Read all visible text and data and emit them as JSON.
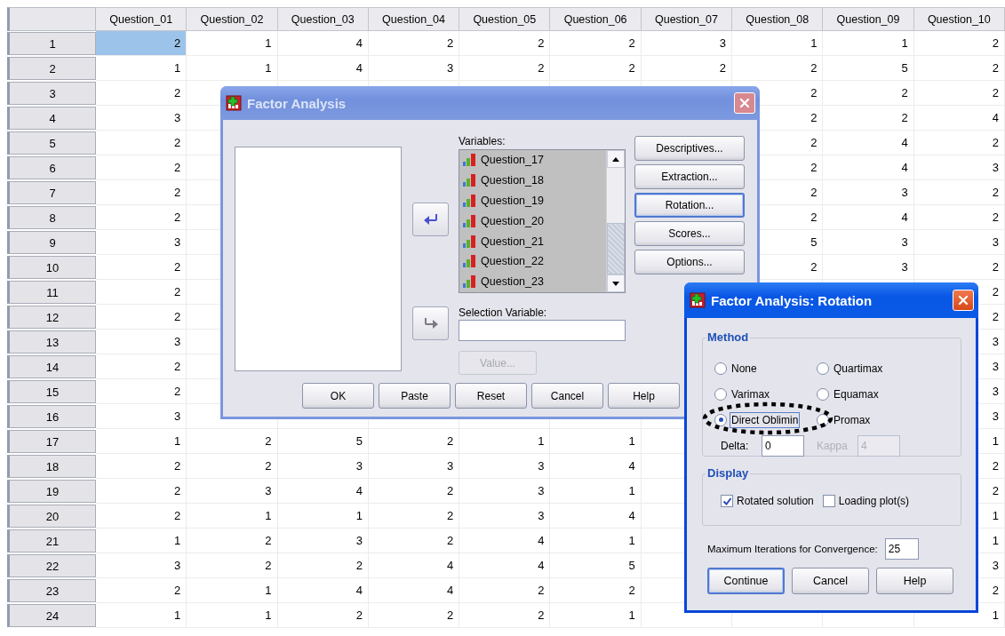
{
  "data_grid": {
    "columns": [
      "Question_01",
      "Question_02",
      "Question_03",
      "Question_04",
      "Question_05",
      "Question_06",
      "Question_07",
      "Question_08",
      "Question_09",
      "Question_10"
    ],
    "rows": [
      {
        "label": "1",
        "cells": [
          {
            "text": "2",
            "selected": true
          },
          {
            "text": "1",
            "selected": false
          },
          {
            "text": "4",
            "selected": false
          },
          {
            "text": "2",
            "selected": false
          },
          {
            "text": "2",
            "selected": false
          },
          {
            "text": "2",
            "selected": false
          },
          {
            "text": "3",
            "selected": false
          },
          {
            "text": "1",
            "selected": false
          },
          {
            "text": "1",
            "selected": false
          },
          {
            "text": "2",
            "selected": false
          }
        ]
      },
      {
        "label": "2",
        "cells": [
          {
            "text": "1",
            "selected": false
          },
          {
            "text": "1",
            "selected": false
          },
          {
            "text": "4",
            "selected": false
          },
          {
            "text": "3",
            "selected": false
          },
          {
            "text": "2",
            "selected": false
          },
          {
            "text": "2",
            "selected": false
          },
          {
            "text": "2",
            "selected": false
          },
          {
            "text": "2",
            "selected": false
          },
          {
            "text": "5",
            "selected": false
          },
          {
            "text": "2",
            "selected": false
          }
        ]
      },
      {
        "label": "3",
        "cells": [
          {
            "text": "2",
            "selected": false
          },
          null,
          null,
          null,
          null,
          null,
          null,
          {
            "text": "2",
            "selected": false
          },
          {
            "text": "2",
            "selected": false
          },
          {
            "text": "2",
            "selected": false
          }
        ]
      },
      {
        "label": "4",
        "cells": [
          {
            "text": "3",
            "selected": false
          },
          null,
          null,
          null,
          null,
          null,
          null,
          {
            "text": "2",
            "selected": false
          },
          {
            "text": "2",
            "selected": false
          },
          {
            "text": "4",
            "selected": false
          }
        ]
      },
      {
        "label": "5",
        "cells": [
          {
            "text": "2",
            "selected": false
          },
          null,
          null,
          null,
          null,
          null,
          null,
          {
            "text": "2",
            "selected": false
          },
          {
            "text": "4",
            "selected": false
          },
          {
            "text": "2",
            "selected": false
          }
        ]
      },
      {
        "label": "6",
        "cells": [
          {
            "text": "2",
            "selected": false
          },
          null,
          null,
          null,
          null,
          null,
          null,
          {
            "text": "2",
            "selected": false
          },
          {
            "text": "4",
            "selected": false
          },
          {
            "text": "3",
            "selected": false
          }
        ]
      },
      {
        "label": "7",
        "cells": [
          {
            "text": "2",
            "selected": false
          },
          null,
          null,
          null,
          null,
          null,
          null,
          {
            "text": "2",
            "selected": false
          },
          {
            "text": "3",
            "selected": false
          },
          {
            "text": "2",
            "selected": false
          }
        ]
      },
      {
        "label": "8",
        "cells": [
          {
            "text": "2",
            "selected": false
          },
          null,
          null,
          null,
          null,
          null,
          null,
          {
            "text": "2",
            "selected": false
          },
          {
            "text": "4",
            "selected": false
          },
          {
            "text": "2",
            "selected": false
          }
        ]
      },
      {
        "label": "9",
        "cells": [
          {
            "text": "3",
            "selected": false
          },
          null,
          null,
          null,
          null,
          null,
          null,
          {
            "text": "5",
            "selected": false
          },
          {
            "text": "3",
            "selected": false
          },
          {
            "text": "3",
            "selected": false
          }
        ]
      },
      {
        "label": "10",
        "cells": [
          {
            "text": "2",
            "selected": false
          },
          null,
          null,
          null,
          null,
          null,
          null,
          {
            "text": "2",
            "selected": false
          },
          {
            "text": "3",
            "selected": false
          },
          {
            "text": "2",
            "selected": false
          }
        ]
      },
      {
        "label": "11",
        "cells": [
          {
            "text": "2",
            "selected": false
          },
          null,
          null,
          null,
          null,
          null,
          null,
          null,
          null,
          {
            "text": "2",
            "selected": false
          }
        ]
      },
      {
        "label": "12",
        "cells": [
          {
            "text": "2",
            "selected": false
          },
          null,
          null,
          null,
          null,
          null,
          null,
          null,
          null,
          {
            "text": "2",
            "selected": false
          }
        ]
      },
      {
        "label": "13",
        "cells": [
          {
            "text": "3",
            "selected": false
          },
          null,
          null,
          null,
          null,
          null,
          null,
          null,
          null,
          {
            "text": "3",
            "selected": false
          }
        ]
      },
      {
        "label": "14",
        "cells": [
          {
            "text": "2",
            "selected": false
          },
          null,
          null,
          null,
          null,
          null,
          null,
          null,
          null,
          {
            "text": "3",
            "selected": false
          }
        ]
      },
      {
        "label": "15",
        "cells": [
          {
            "text": "2",
            "selected": false
          },
          null,
          null,
          null,
          null,
          null,
          null,
          null,
          null,
          {
            "text": "3",
            "selected": false
          }
        ]
      },
      {
        "label": "16",
        "cells": [
          {
            "text": "3",
            "selected": false
          },
          null,
          null,
          null,
          null,
          null,
          null,
          null,
          null,
          {
            "text": "3",
            "selected": false
          }
        ]
      },
      {
        "label": "17",
        "cells": [
          {
            "text": "1",
            "selected": false
          },
          {
            "text": "2",
            "selected": false
          },
          {
            "text": "5",
            "selected": false
          },
          {
            "text": "2",
            "selected": false
          },
          {
            "text": "1",
            "selected": false
          },
          {
            "text": "1",
            "selected": false
          },
          null,
          null,
          null,
          {
            "text": "1",
            "selected": false
          }
        ]
      },
      {
        "label": "18",
        "cells": [
          {
            "text": "2",
            "selected": false
          },
          {
            "text": "2",
            "selected": false
          },
          {
            "text": "3",
            "selected": false
          },
          {
            "text": "3",
            "selected": false
          },
          {
            "text": "3",
            "selected": false
          },
          {
            "text": "4",
            "selected": false
          },
          null,
          null,
          null,
          {
            "text": "2",
            "selected": false
          }
        ]
      },
      {
        "label": "19",
        "cells": [
          {
            "text": "2",
            "selected": false
          },
          {
            "text": "3",
            "selected": false
          },
          {
            "text": "4",
            "selected": false
          },
          {
            "text": "2",
            "selected": false
          },
          {
            "text": "3",
            "selected": false
          },
          {
            "text": "1",
            "selected": false
          },
          null,
          null,
          null,
          {
            "text": "2",
            "selected": false
          }
        ]
      },
      {
        "label": "20",
        "cells": [
          {
            "text": "2",
            "selected": false
          },
          {
            "text": "1",
            "selected": false
          },
          {
            "text": "1",
            "selected": false
          },
          {
            "text": "2",
            "selected": false
          },
          {
            "text": "3",
            "selected": false
          },
          {
            "text": "4",
            "selected": false
          },
          null,
          null,
          null,
          {
            "text": "1",
            "selected": false
          }
        ]
      },
      {
        "label": "21",
        "cells": [
          {
            "text": "1",
            "selected": false
          },
          {
            "text": "2",
            "selected": false
          },
          {
            "text": "3",
            "selected": false
          },
          {
            "text": "2",
            "selected": false
          },
          {
            "text": "4",
            "selected": false
          },
          {
            "text": "1",
            "selected": false
          },
          null,
          null,
          null,
          {
            "text": "1",
            "selected": false
          }
        ]
      },
      {
        "label": "22",
        "cells": [
          {
            "text": "3",
            "selected": false
          },
          {
            "text": "2",
            "selected": false
          },
          {
            "text": "2",
            "selected": false
          },
          {
            "text": "4",
            "selected": false
          },
          {
            "text": "4",
            "selected": false
          },
          {
            "text": "5",
            "selected": false
          },
          null,
          null,
          null,
          {
            "text": "3",
            "selected": false
          }
        ]
      },
      {
        "label": "23",
        "cells": [
          {
            "text": "2",
            "selected": false
          },
          {
            "text": "1",
            "selected": false
          },
          {
            "text": "4",
            "selected": false
          },
          {
            "text": "4",
            "selected": false
          },
          {
            "text": "2",
            "selected": false
          },
          {
            "text": "2",
            "selected": false
          },
          null,
          null,
          null,
          {
            "text": "2",
            "selected": false
          }
        ]
      },
      {
        "label": "24",
        "cells": [
          {
            "text": "1",
            "selected": false
          },
          {
            "text": "1",
            "selected": false
          },
          {
            "text": "2",
            "selected": false
          },
          {
            "text": "2",
            "selected": false
          },
          {
            "text": "2",
            "selected": false
          },
          {
            "text": "1",
            "selected": false
          },
          null,
          null,
          null,
          {
            "text": "1",
            "selected": false
          }
        ]
      }
    ]
  },
  "factor_analysis_dialog": {
    "title": "Factor Analysis",
    "active": false,
    "variables_label": "Variables:",
    "variables": [
      {
        "name": "Question_17",
        "selected": true
      },
      {
        "name": "Question_18",
        "selected": true
      },
      {
        "name": "Question_19",
        "selected": true
      },
      {
        "name": "Question_20",
        "selected": true
      },
      {
        "name": "Question_21",
        "selected": true
      },
      {
        "name": "Question_22",
        "selected": true
      },
      {
        "name": "Question_23",
        "selected": true
      }
    ],
    "selection_variable_label": "Selection Variable:",
    "value_button": {
      "label": "Value...",
      "disabled": true
    },
    "side_buttons": [
      {
        "label": "Descriptives...",
        "focused": false
      },
      {
        "label": "Extraction...",
        "focused": false
      },
      {
        "label": "Rotation...",
        "focused": true
      },
      {
        "label": "Scores...",
        "focused": false
      },
      {
        "label": "Options...",
        "focused": false
      }
    ],
    "bottom_buttons": [
      {
        "label": "OK",
        "focused": false
      },
      {
        "label": "Paste",
        "focused": false
      },
      {
        "label": "Reset",
        "focused": false
      },
      {
        "label": "Cancel",
        "focused": false
      },
      {
        "label": "Help",
        "focused": false
      }
    ]
  },
  "rotation_dialog": {
    "title": "Factor Analysis: Rotation",
    "active": true,
    "method_label": "Method",
    "methods": [
      {
        "label": "None",
        "selected": false
      },
      {
        "label": "Quartimax",
        "selected": false
      },
      {
        "label": "Varimax",
        "selected": false
      },
      {
        "label": "Equamax",
        "selected": false
      },
      {
        "label": "Direct Oblimin",
        "selected": true
      },
      {
        "label": "Promax",
        "selected": false
      }
    ],
    "delta": {
      "label": "Delta:",
      "value": "0",
      "disabled": false
    },
    "kappa": {
      "label": "Kappa",
      "value": "4",
      "disabled": true
    },
    "display_label": "Display",
    "display_options": [
      {
        "label": "Rotated solution",
        "checked": true
      },
      {
        "label": "Loading plot(s)",
        "checked": false
      }
    ],
    "max_iterations": {
      "label": "Maximum Iterations for Convergence:",
      "value": "25"
    },
    "buttons": [
      {
        "label": "Continue",
        "focused": true
      },
      {
        "label": "Cancel",
        "focused": false
      },
      {
        "label": "Help",
        "focused": false
      }
    ]
  },
  "annotation": {
    "kind": "ellipse"
  }
}
